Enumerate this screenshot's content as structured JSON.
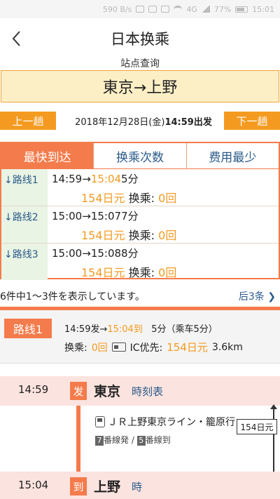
{
  "status_bar": {
    "speed": "590 B/s",
    "signal_badge": "4G",
    "battery": "77%",
    "time": "15:01"
  },
  "header": {
    "title": "日本换乘",
    "subtitle": "站点查询"
  },
  "route": "東京→上野",
  "nav": {
    "prev_label": "上一趟",
    "next_label": "下一趟",
    "date": "2018年12月28日(金)",
    "depart_time": "14:59出发"
  },
  "tabs": [
    {
      "label": "最快到达"
    },
    {
      "label": "换乘次数"
    },
    {
      "label": "费用最少"
    }
  ],
  "routes": [
    {
      "label": "↓路线1",
      "dep": "14:59",
      "arrow": "→",
      "arr": "15:04",
      "duration": "5分",
      "fare": "154日元",
      "transfer_label": "换乘:",
      "transfers": "0回"
    },
    {
      "label": "↓路线2",
      "dep": "15:00",
      "arrow": "→",
      "arr": "15:07",
      "duration": "7分",
      "fare": "154日元",
      "transfer_label": "换乘:",
      "transfers": "0回"
    },
    {
      "label": "↓路线3",
      "dep": "15:00",
      "arrow": "→",
      "arr": "15:08",
      "duration": "8分",
      "fare": "154日元",
      "transfer_label": "换乘:",
      "transfers": "0回"
    }
  ],
  "result_count": "6件中1〜3件を表示しています。",
  "more_label": "后3条",
  "summary": {
    "badge": "路线1",
    "depart": "14:59发→",
    "arrive": "15:04到",
    "duration": "5分（乘车5分）",
    "transfer_label": "换乘:",
    "transfers": "0回",
    "ic_label": "IC优先:",
    "fare": "154日元",
    "distance": "3.6km"
  },
  "timeline": {
    "start": {
      "time": "14:59",
      "tag": "发",
      "name": "東京",
      "link": "時刻表"
    },
    "train": "ＪＲ上野東京ライン・籠原行",
    "depart_track": "7",
    "depart_track_label": "番線発 /",
    "arrive_track": "5",
    "arrive_track_label": "番線到",
    "fare_tag": "154日元",
    "end": {
      "time": "15:04",
      "tag": "到",
      "name": "上野",
      "link": "時"
    }
  }
}
